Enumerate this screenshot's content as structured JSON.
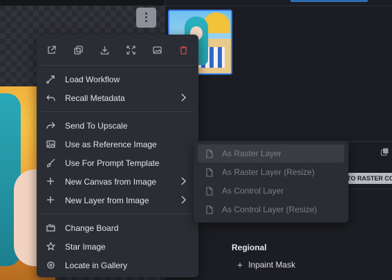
{
  "canvas": {
    "options_button_glyph": "⋮"
  },
  "context_menu": {
    "quick_actions": [
      {
        "icon": "open-in-new-tab-icon"
      },
      {
        "icon": "copy-icon"
      },
      {
        "icon": "download-icon"
      },
      {
        "icon": "fullscreen-icon"
      },
      {
        "icon": "image-icon"
      },
      {
        "icon": "trash-icon",
        "color": "#c0505a"
      }
    ],
    "groups": [
      [
        {
          "label": "Load Workflow",
          "icon": "flow-arrow-icon"
        },
        {
          "label": "Recall Metadata",
          "icon": "undo-arrow-icon",
          "has_submenu": true
        }
      ],
      [
        {
          "label": "Send To Upscale",
          "icon": "share-arrow-icon"
        },
        {
          "label": "Use as Reference Image",
          "icon": "image-icon"
        },
        {
          "label": "Use For Prompt Template",
          "icon": "paintbrush-icon"
        },
        {
          "label": "New Canvas from Image",
          "icon": "plus-icon",
          "has_submenu": true
        },
        {
          "label": "New Layer from Image",
          "icon": "plus-icon",
          "has_submenu": true
        }
      ],
      [
        {
          "label": "Change Board",
          "icon": "folders-icon"
        },
        {
          "label": "Star Image",
          "icon": "star-icon"
        },
        {
          "label": "Locate in Gallery",
          "icon": "crosshair-icon"
        }
      ]
    ]
  },
  "submenu": {
    "items": [
      {
        "label": "As Raster Layer",
        "highlighted": true
      },
      {
        "label": "As Raster Layer (Resize)"
      },
      {
        "label": "As Control Layer"
      },
      {
        "label": "As Control Layer (Resize)"
      }
    ]
  },
  "right_panel": {
    "chip_label": "TO RASTER CO",
    "regional_heading": "Regional",
    "inpaint_label": "Inpaint Mask"
  },
  "colors": {
    "accent": "#3b82f6",
    "menu_bg": "#2b2d34",
    "danger": "#c0505a"
  }
}
